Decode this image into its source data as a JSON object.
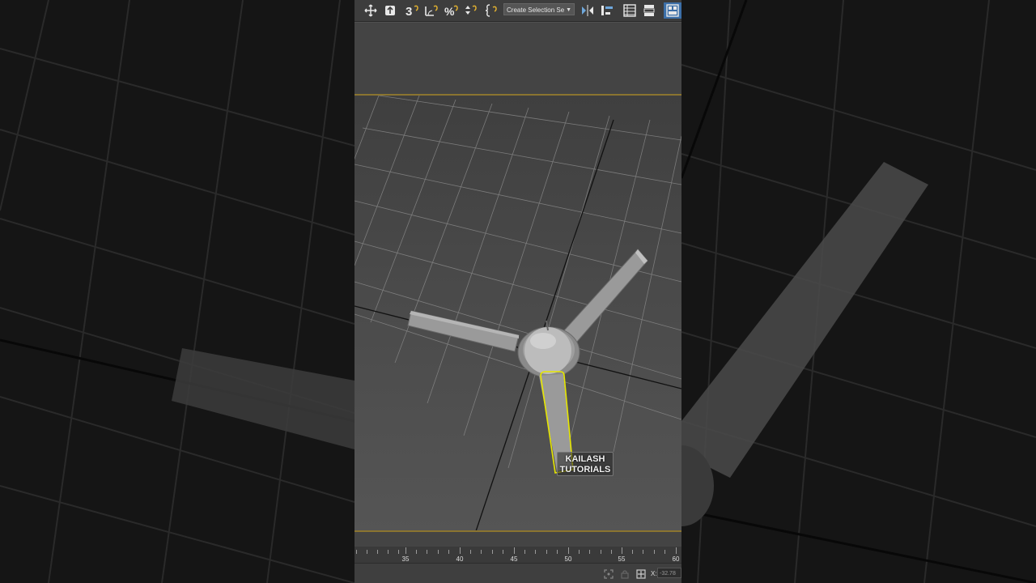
{
  "toolbar": {
    "selection_set_placeholder": "Create Selection Se",
    "icons": [
      "move-icon",
      "select-and-place-icon",
      "snap-3d-icon",
      "angle-snap-icon",
      "percent-snap-icon",
      "spinner-snap-icon",
      "edit-named-selection-icon",
      "mirror-icon",
      "align-icon",
      "scene-explorer-icon",
      "layer-explorer-icon",
      "ribbon-toggle-icon"
    ]
  },
  "viewport": {
    "watermark_line1": "KAILASH",
    "watermark_line2": "TUTORIALS",
    "selection_color": "#e6e600",
    "object": "ceiling-fan"
  },
  "timeline": {
    "ticks": [
      "35",
      "40",
      "45",
      "50",
      "55",
      "60"
    ]
  },
  "status": {
    "x_label": "X:",
    "x_value": "-32.78"
  },
  "colors": {
    "viewport_border": "#8a7430",
    "toolbar_bg": "#3d3d3d"
  }
}
